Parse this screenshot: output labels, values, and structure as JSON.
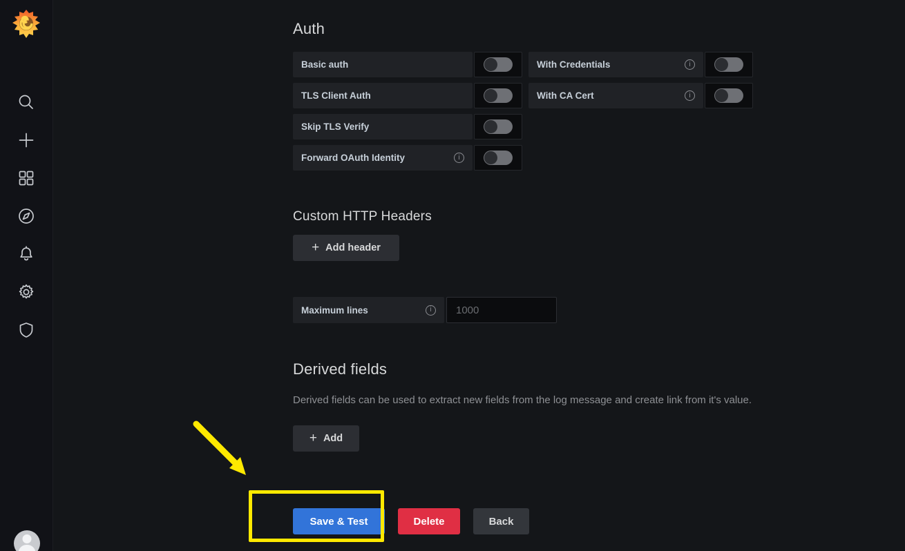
{
  "app": {
    "brand_icon": "grafana-logo-icon",
    "accent_blue": "#3274d9",
    "danger_red": "#e02f44",
    "annotation_yellow": "#ffe900",
    "background": "#141619",
    "sidebar_background": "#111217"
  },
  "sidebar": {
    "items": [
      {
        "name": "search",
        "icon": "search-icon"
      },
      {
        "name": "create",
        "icon": "plus-icon"
      },
      {
        "name": "dashboards",
        "icon": "apps-grid-icon"
      },
      {
        "name": "explore",
        "icon": "compass-icon"
      },
      {
        "name": "alerting",
        "icon": "bell-icon"
      },
      {
        "name": "configuration",
        "icon": "gear-icon"
      },
      {
        "name": "server-admin",
        "icon": "shield-icon"
      }
    ],
    "avatar": {
      "icon": "user-avatar-icon"
    }
  },
  "auth": {
    "title": "Auth",
    "left_fields": [
      {
        "label": "Basic auth",
        "has_info": false,
        "toggle_on": false
      },
      {
        "label": "TLS Client Auth",
        "has_info": false,
        "toggle_on": false
      },
      {
        "label": "Skip TLS Verify",
        "has_info": false,
        "toggle_on": false
      },
      {
        "label": "Forward OAuth Identity",
        "has_info": true,
        "toggle_on": false
      }
    ],
    "right_fields": [
      {
        "label": "With Credentials",
        "has_info": true,
        "toggle_on": false
      },
      {
        "label": "With CA Cert",
        "has_info": true,
        "toggle_on": false
      }
    ]
  },
  "custom_headers": {
    "title": "Custom HTTP Headers",
    "add_button_label": "Add header",
    "add_button_icon": "plus-icon"
  },
  "max_lines": {
    "label": "Maximum lines",
    "has_info": true,
    "value": "",
    "placeholder": "1000"
  },
  "derived_fields": {
    "title": "Derived fields",
    "description": "Derived fields can be used to extract new fields from the log message and create link from it's value.",
    "add_button_label": "Add",
    "add_button_icon": "plus-icon"
  },
  "footer": {
    "save_test_label": "Save & Test",
    "delete_label": "Delete",
    "back_label": "Back"
  },
  "annotations": {
    "highlight_target": "save-test-button",
    "arrow_icon": "arrow-down-right-icon"
  }
}
